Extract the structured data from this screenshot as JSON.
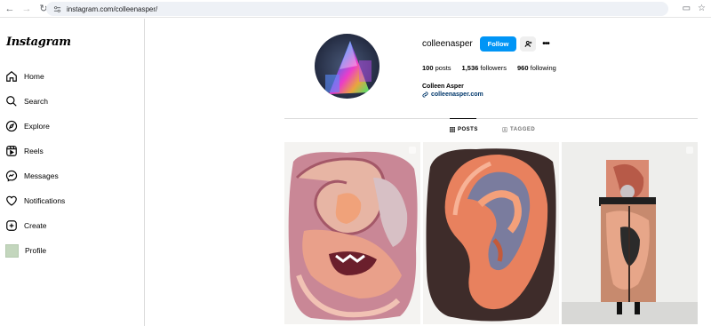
{
  "browser": {
    "url": "instagram.com/colleenasper/"
  },
  "sidebar": {
    "logo": "Instagram",
    "items": [
      {
        "label": "Home"
      },
      {
        "label": "Search"
      },
      {
        "label": "Explore"
      },
      {
        "label": "Reels"
      },
      {
        "label": "Messages"
      },
      {
        "label": "Notifications"
      },
      {
        "label": "Create"
      },
      {
        "label": "Profile"
      }
    ]
  },
  "profile": {
    "username": "colleenasper",
    "follow_label": "Follow",
    "posts_count": "100",
    "posts_label": "posts",
    "followers_count": "1,536",
    "followers_label": "followers",
    "following_count": "960",
    "following_label": "following",
    "full_name": "Colleen Asper",
    "website": "colleenasper.com"
  },
  "tabs": [
    {
      "label": "POSTS",
      "active": true
    },
    {
      "label": "TAGGED",
      "active": false
    }
  ],
  "colors": {
    "accent": "#0095f6",
    "link": "#00376b"
  }
}
